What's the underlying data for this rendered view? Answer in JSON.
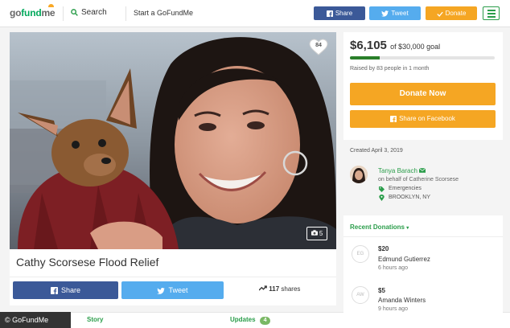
{
  "nav": {
    "logo_go": "go",
    "logo_fund": "fund",
    "logo_me": "me",
    "search_label": "Search",
    "start_label": "Start a GoFundMe",
    "share_label": "Share",
    "tweet_label": "Tweet",
    "donate_label": "Donate"
  },
  "campaign": {
    "title": "Cathy Scorsese Flood Relief",
    "hearts": "84",
    "photo_count": "5",
    "share_button": "Share",
    "tweet_button": "Tweet",
    "shares_count": "117",
    "shares_label": "shares"
  },
  "tabs": {
    "story": "Story",
    "updates": "Updates",
    "updates_count": "4"
  },
  "credit": "© GoFundMe",
  "fundraising": {
    "raised": "$6,105",
    "goal_text": "of $30,000 goal",
    "progress": 0.2035,
    "raised_by": "Raised by 83 people in 1 month",
    "donate_now": "Donate Now",
    "share_facebook": "Share on Facebook"
  },
  "created": "Created April 3, 2019",
  "organizer": {
    "name": "Tanya Barach",
    "behalf": "on behalf of Catherine Scorsese",
    "category": "Emergencies",
    "location": "BROOKLYN, NY"
  },
  "donations": {
    "header": "Recent Donations",
    "caret": "▾",
    "items": [
      {
        "initials": "EG",
        "amount": "$20",
        "name": "Edmund Gutierrez",
        "time": "6 hours ago"
      },
      {
        "initials": "AW",
        "amount": "$5",
        "name": "Amanda Winters",
        "time": "9 hours ago"
      }
    ]
  },
  "colors": {
    "brand_green": "#2a9d4a",
    "donate_orange": "#f5a623",
    "facebook_blue": "#3b5998",
    "twitter_blue": "#55acee"
  },
  "icons": [
    "search-icon",
    "facebook-icon",
    "twitter-icon",
    "donate-icon",
    "menu-icon",
    "heart-icon",
    "camera-icon",
    "trend-icon",
    "email-icon",
    "tag-icon",
    "pin-icon"
  ]
}
